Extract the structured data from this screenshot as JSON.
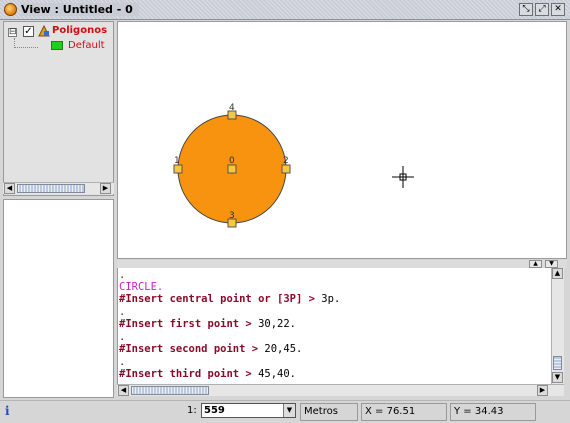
{
  "window": {
    "title": "View : Untitled - 0",
    "icon": "gvsig-globe-icon",
    "buttons": [
      "restore-icon",
      "maximize-icon",
      "close-icon"
    ]
  },
  "toc": {
    "layer": {
      "name": "Poligonos",
      "checked": true,
      "expander": "⊟",
      "color": "#d01010"
    },
    "legend": {
      "label": "Default",
      "symbol_color": "#22cc22"
    }
  },
  "map": {
    "circle_fill": "#f7930f",
    "vertex_labels": [
      "0",
      "1",
      "2",
      "3",
      "4"
    ],
    "cursor": "crosshair-cursor-icon"
  },
  "console": {
    "lines": [
      {
        "type": "dot",
        "text": "."
      },
      {
        "type": "cmd",
        "text": "CIRCLE."
      },
      {
        "type": "prompt",
        "text": "#Insert central point or [3P] > ",
        "input": "3p."
      },
      {
        "type": "dot",
        "text": "."
      },
      {
        "type": "prompt",
        "text": "#Insert first point > ",
        "input": "30,22."
      },
      {
        "type": "dot",
        "text": "."
      },
      {
        "type": "prompt",
        "text": "#Insert second point > ",
        "input": "20,45."
      },
      {
        "type": "dot",
        "text": "."
      },
      {
        "type": "prompt",
        "text": "#Insert third point > ",
        "input": "45,40."
      }
    ]
  },
  "statusbar": {
    "info": "i",
    "scale_prefix": "1:",
    "scale_value": "559",
    "units": "Metros",
    "x_label": "X = 76.51",
    "y_label": "Y = 34.43"
  }
}
